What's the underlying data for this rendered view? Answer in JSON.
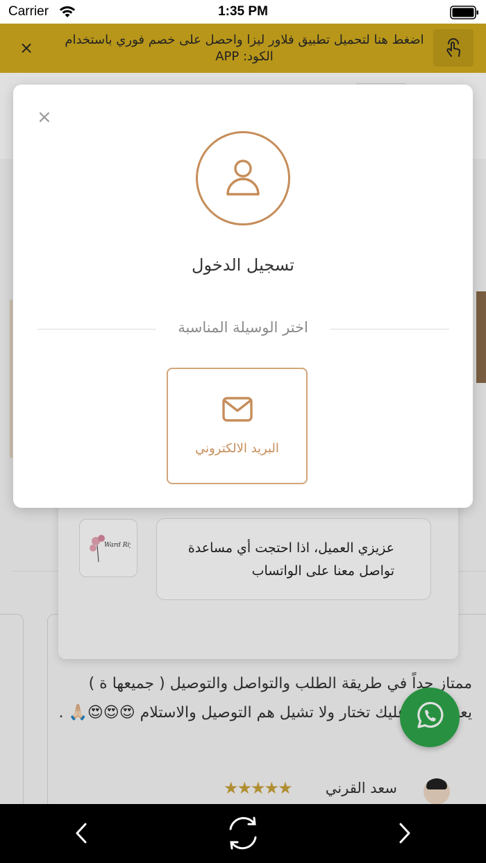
{
  "status_bar": {
    "carrier": "Carrier",
    "time": "1:35 PM"
  },
  "promo_banner": {
    "text": "اضغط هنا لتحميل تطبيق فلاور ليزا واحصل على خصم فوري باستخدام الكود: APP",
    "close_label": "×",
    "background_color": "#b8961a"
  },
  "background_page": {
    "chat": {
      "message": "عزيزي العميل، اذا احتجت أي مساعدة تواصل معنا على الواتساب",
      "logo_text": "Ward Riyadh"
    },
    "review": {
      "text": "ممتاز جداً في طريقة الطلب والتواصل والتوصيل ( جميعها ة ) يعني اللي عليك تختار ولا تشيل هم التوصيل والاستلام 😍😍😍🙏🏻 .",
      "reviewer_name": "سعد القرني",
      "rating": 5,
      "stars": "★★★★★"
    }
  },
  "login_modal": {
    "close_label": "×",
    "title": "تسجيل الدخول",
    "choose_method": "اختر الوسيلة المناسبة",
    "email_option_label": "البريد الالكتروني",
    "accent_color": "#c68d5a"
  },
  "icons": {
    "user": "user-icon",
    "email": "envelope-icon",
    "whatsapp": "whatsapp-icon",
    "tap": "tap-hand-icon"
  }
}
